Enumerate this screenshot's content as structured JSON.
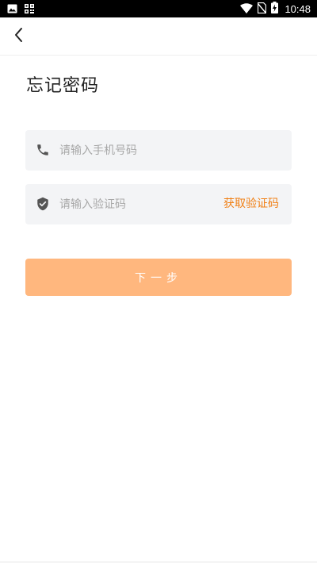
{
  "status_bar": {
    "time": "10:48",
    "left_icons": [
      "image-icon",
      "qr-code-icon"
    ],
    "right_icons": [
      "wifi-icon",
      "no-sim-icon",
      "battery-charging-icon"
    ]
  },
  "nav": {
    "back_icon": "chevron-left-icon"
  },
  "page": {
    "title": "忘记密码"
  },
  "form": {
    "phone": {
      "placeholder": "请输入手机号码",
      "value": "",
      "icon": "phone-icon"
    },
    "code": {
      "placeholder": "请输入验证码",
      "value": "",
      "icon": "shield-check-icon"
    },
    "get_code_label": "获取验证码",
    "next_label": "下一步"
  },
  "colors": {
    "accent": "#f07f14",
    "button_bg": "#ffb77e",
    "field_bg": "#f3f4f6",
    "status_bar_bg": "#000000"
  }
}
